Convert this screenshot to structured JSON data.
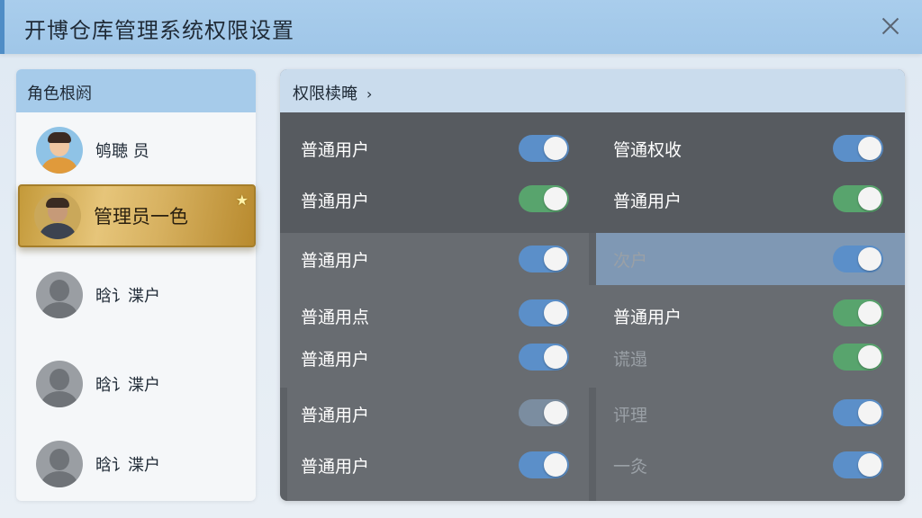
{
  "window": {
    "title": "开博仓库管理系统权限设置"
  },
  "roles": {
    "header": "角色根阏",
    "items": [
      {
        "label": "鸲聴 员",
        "avatar": "user-avatar-icon",
        "active": false
      },
      {
        "label": "管理员一色",
        "avatar": "admin-avatar-icon",
        "active": true
      },
      {
        "label": "晗讠渫户",
        "avatar": "user-avatar-icon",
        "active": false
      },
      {
        "label": "晗讠渫户",
        "avatar": "user-avatar-icon",
        "active": false
      },
      {
        "label": "晗讠渫户",
        "avatar": "user-avatar-icon",
        "active": false
      }
    ]
  },
  "permissions": {
    "header": "权限椟晻",
    "left": [
      {
        "label": "普通用户",
        "on": true,
        "color": "#5b8fc9"
      },
      {
        "label": "普通用户",
        "on": true,
        "color": "#58a46d"
      },
      {
        "label": "普通用户",
        "on": true,
        "color": "#5b8fc9"
      },
      {
        "label": "普通用点",
        "on": true,
        "color": "#5b8fc9"
      },
      {
        "label": "普通用户",
        "on": true,
        "color": "#5b8fc9"
      },
      {
        "label": "普通用户",
        "on": true,
        "color": "#7b8da0"
      },
      {
        "label": "普通用户",
        "on": true,
        "color": "#5b8fc9"
      }
    ],
    "right": [
      {
        "label": "管通权收",
        "on": true,
        "color": "#5b8fc9"
      },
      {
        "label": "普通用户",
        "on": true,
        "color": "#58a46d"
      },
      {
        "label": "次户",
        "on": true,
        "color": "#5b8fc9"
      },
      {
        "label": "普通用户",
        "on": true,
        "color": "#58a46d"
      },
      {
        "label": "谎遢",
        "on": true,
        "color": "#58a46d"
      },
      {
        "label": "评理",
        "on": true,
        "color": "#5b8fc9"
      },
      {
        "label": "一灸",
        "on": true,
        "color": "#5b8fc9"
      }
    ]
  }
}
